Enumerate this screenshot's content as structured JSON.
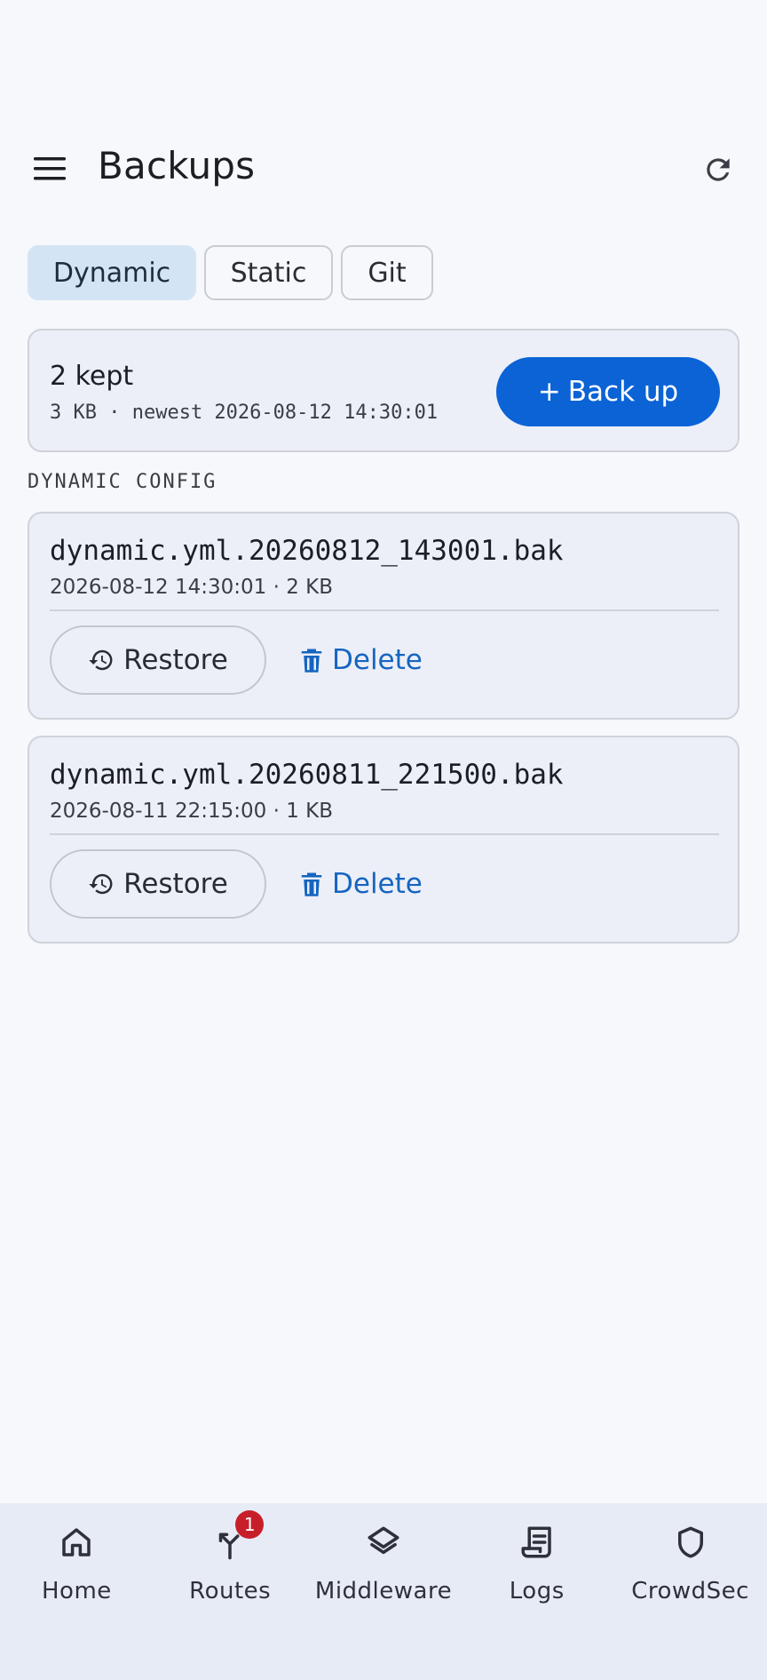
{
  "header": {
    "title": "Backups"
  },
  "tabs": [
    {
      "label": "Dynamic",
      "active": true
    },
    {
      "label": "Static",
      "active": false
    },
    {
      "label": "Git",
      "active": false
    }
  ],
  "summary": {
    "count": "2 kept",
    "meta": "3 KB · newest 2026-08-12 14:30:01",
    "backup_button": "Back up",
    "backup_icon": "+"
  },
  "section_label": "DYNAMIC CONFIG",
  "files": [
    {
      "name": "dynamic.yml.20260812_143001.bak",
      "meta": "2026-08-12 14:30:01 · 2 KB",
      "restore_label": "Restore",
      "delete_label": "Delete"
    },
    {
      "name": "dynamic.yml.20260811_221500.bak",
      "meta": "2026-08-11 22:15:00 · 1 KB",
      "restore_label": "Restore",
      "delete_label": "Delete"
    }
  ],
  "nav": [
    {
      "label": "Home",
      "icon": "home-icon"
    },
    {
      "label": "Routes",
      "icon": "routes-icon",
      "badge": "1"
    },
    {
      "label": "Middleware",
      "icon": "layers-icon"
    },
    {
      "label": "Logs",
      "icon": "logs-icon"
    },
    {
      "label": "CrowdSec",
      "icon": "shield-icon"
    }
  ],
  "colors": {
    "accent": "#0b63d6",
    "link": "#1565c0",
    "active_tab": "#d3e4f5",
    "badge": "#c71f2a",
    "card_bg": "#eceff8",
    "nav_bg": "#e7ebf6"
  }
}
